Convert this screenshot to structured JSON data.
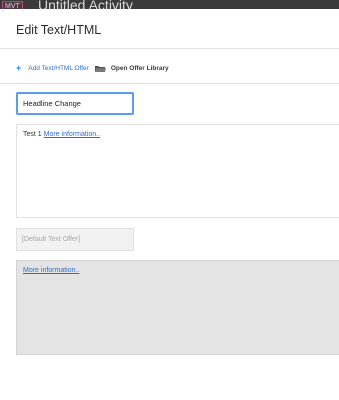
{
  "background": {
    "badge": "MVT",
    "activity_title": "Untitled Activity"
  },
  "modal": {
    "title": "Edit Text/HTML",
    "toolbar": {
      "add_offer_label": "Add Text/HTML Offer",
      "open_library_label": "Open Offer Library"
    },
    "name_input_value": "Headline Change",
    "editor": {
      "text": "Test 1",
      "link": "More information.."
    },
    "default_offer_label": "[Default Text Offer]",
    "preview": {
      "link": "More information.."
    }
  },
  "colors": {
    "accent": "#2680eb",
    "link": "#2f6fc6",
    "focus_border": "#5b9cf0",
    "backdrop": "#3f3f3f"
  },
  "icons": {
    "add": "plus-icon",
    "library": "folder-icon"
  }
}
